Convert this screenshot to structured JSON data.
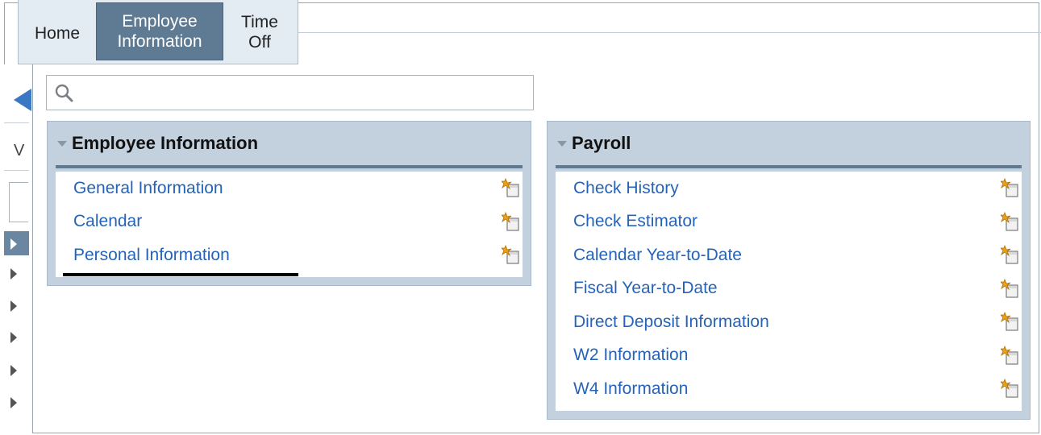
{
  "tabs": [
    {
      "label_line1": "Home",
      "label_line2": "",
      "active": false
    },
    {
      "label_line1": "Employee",
      "label_line2": "Information",
      "active": true
    },
    {
      "label_line1": "Time",
      "label_line2": "Off",
      "active": false
    }
  ],
  "side_panel": {
    "letter": "V"
  },
  "search": {
    "value": "",
    "placeholder": ""
  },
  "panels": {
    "employee": {
      "title": "Employee Information",
      "items": [
        "General Information",
        "Calendar",
        "Personal Information"
      ]
    },
    "payroll": {
      "title": "Payroll",
      "items": [
        "Check History",
        "Check Estimator",
        "Calendar Year-to-Date",
        "Fiscal Year-to-Date",
        "Direct Deposit Information",
        "W2 Information",
        "W4 Information"
      ]
    }
  },
  "colors": {
    "active_tab": "#5f7a93",
    "link": "#2563b8",
    "panel_bg": "#c3d0dd",
    "accent_arrow": "#3b78c4"
  },
  "icons": {
    "item_icon": "new-window-icon",
    "search": "search-icon"
  }
}
